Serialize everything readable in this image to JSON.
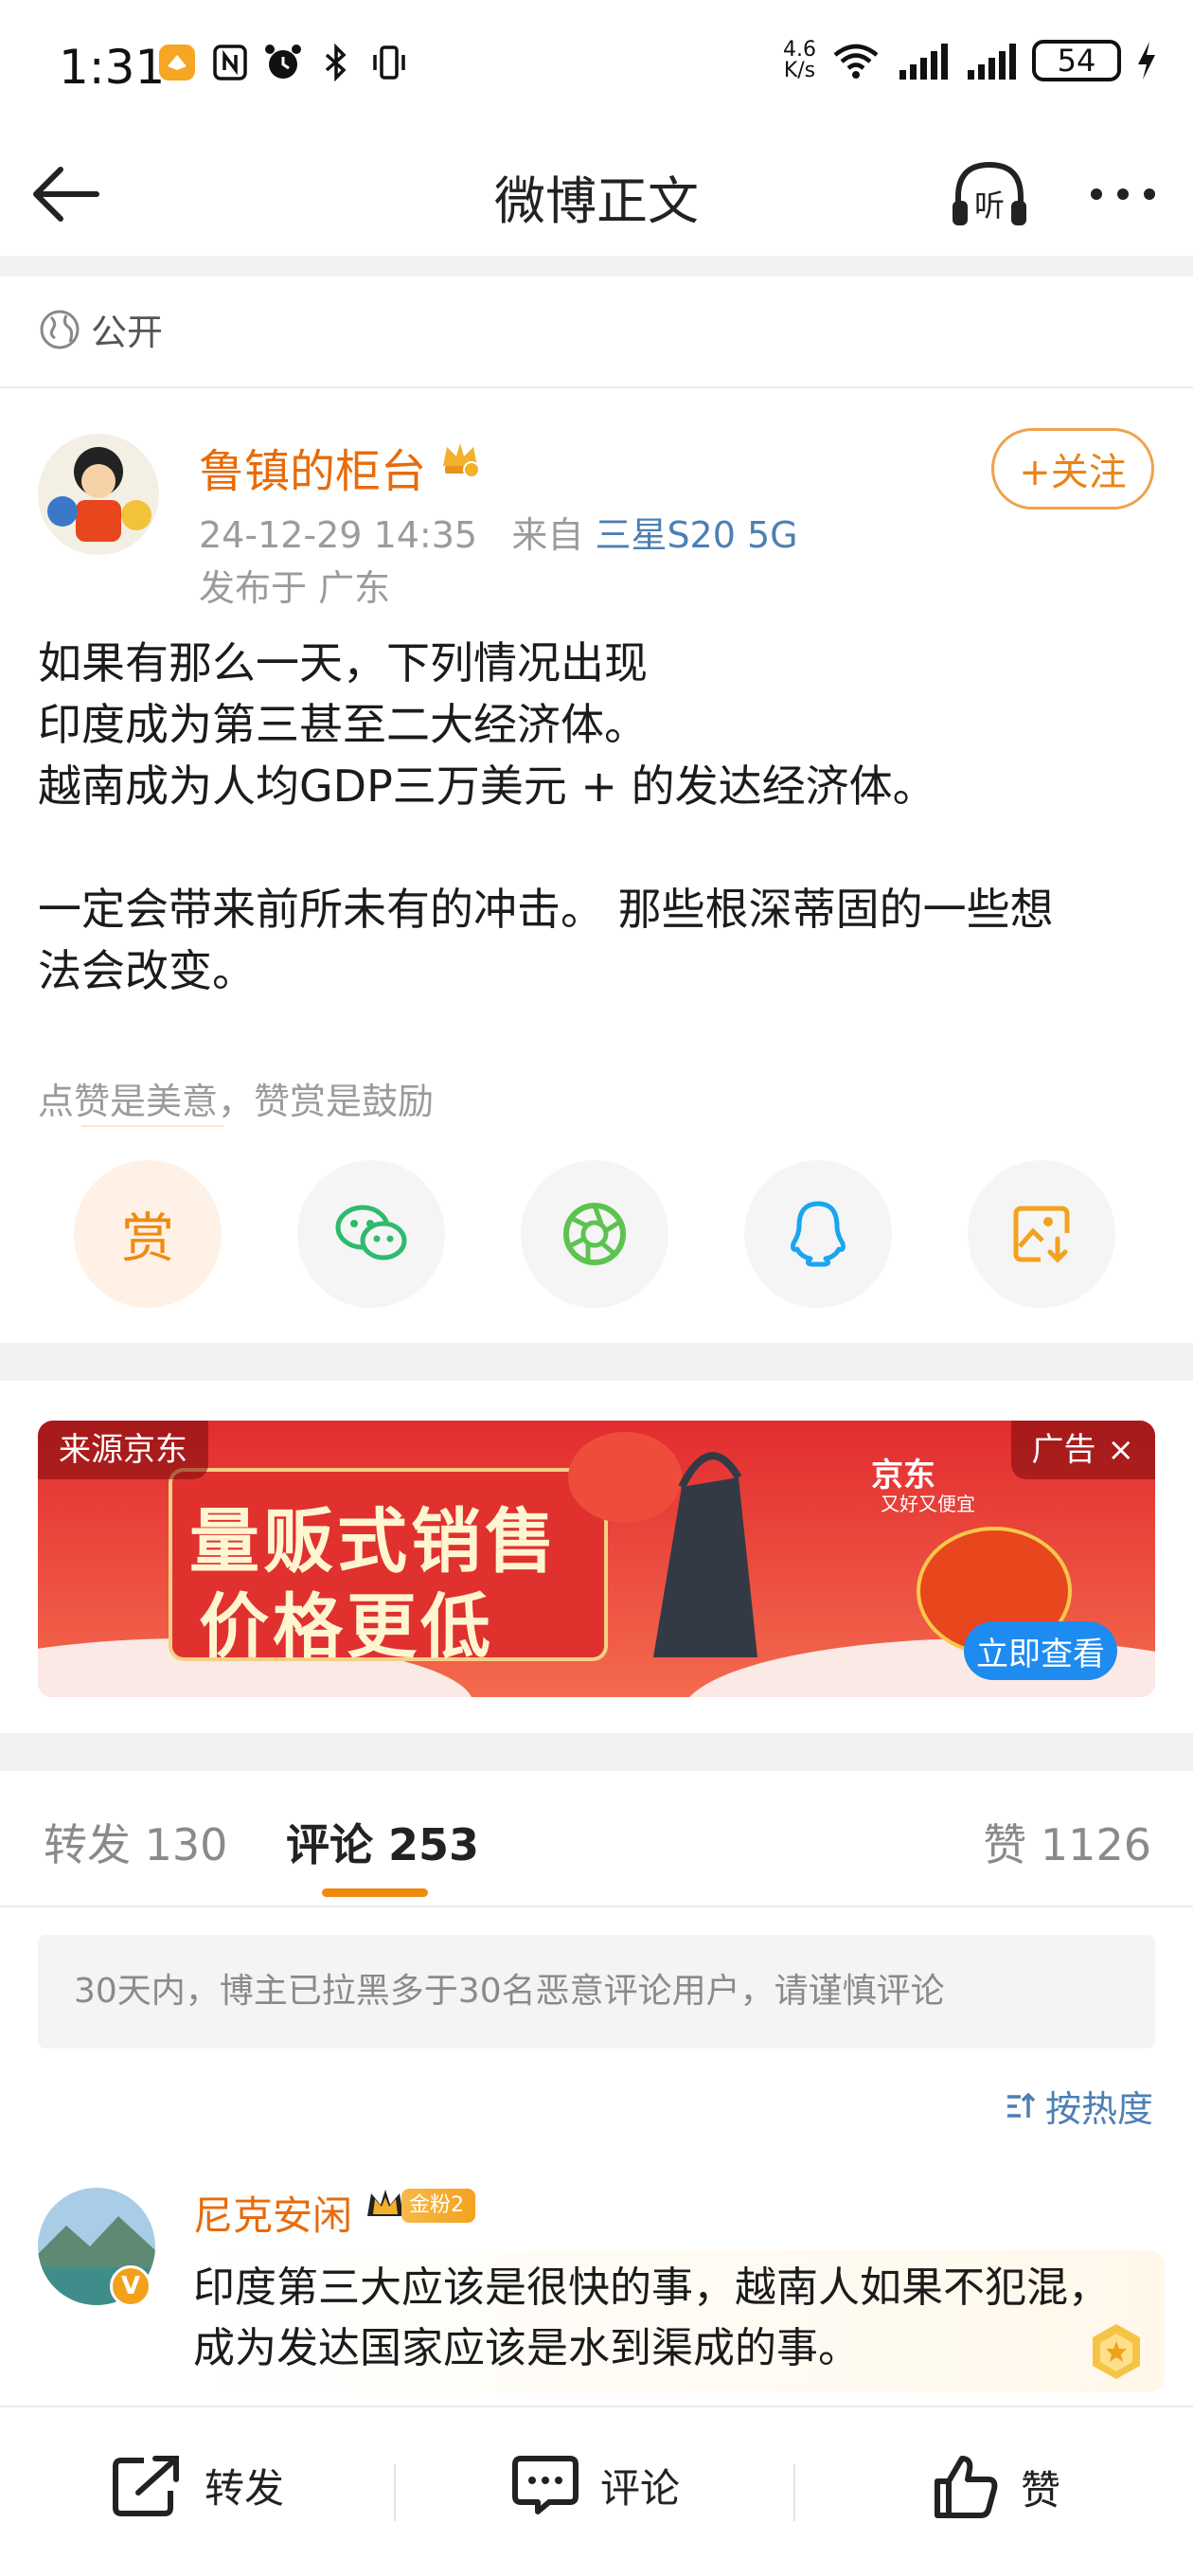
{
  "status_bar": {
    "time": "1:31",
    "net_speed_value": "4.6",
    "net_speed_unit": "K/s",
    "battery": "54"
  },
  "nav": {
    "title": "微博正文",
    "listen_label": "听"
  },
  "visibility": {
    "label": "公开"
  },
  "post": {
    "author": "鲁镇的柜台",
    "timestamp": "24-12-29 14:35",
    "from_prefix": "来自",
    "device": "三星S20 5G",
    "location": "发布于 广东",
    "follow_label": "+关注",
    "lines": [
      "如果有那么一天，下列情况出现",
      "印度成为第三甚至二大经济体。",
      "越南成为人均GDP三万美元 + 的发达经济体。",
      "",
      "一定会带来前所未有的冲击。 那些根深蒂固的一些想",
      "法会改变。"
    ],
    "tip_text": "点赞是美意，赞赏是鼓励",
    "reward_label": "赏"
  },
  "ad": {
    "source": "来源京东",
    "tag": "广告",
    "close": "×",
    "line1": "量贩式销售",
    "line2": "价格更低",
    "brand": "京东",
    "brand_sub": "又好又便宜",
    "cta": "立即查看"
  },
  "tabs": {
    "repost": "转发 130",
    "comment": "评论 253",
    "like": "赞 1126"
  },
  "notice": "30天内，博主已拉黑多于30名恶意评论用户，请谨慎评论",
  "sort_label": "按热度",
  "comment": {
    "name": "尼克安闲",
    "fan_badge": "金粉2",
    "v_badge": "V",
    "text": "印度第三大应该是很快的事，越南人如果不犯混，成为发达国家应该是水到渠成的事。"
  },
  "bottom_bar": {
    "repost": "转发",
    "comment": "评论",
    "like": "赞"
  },
  "colors": {
    "accent_orange": "#e86b0a",
    "link_blue": "#4d7fb3",
    "tab_underline": "#f08a0e",
    "ad_red": "#e8373a",
    "cta_blue": "#1e8bf0"
  }
}
